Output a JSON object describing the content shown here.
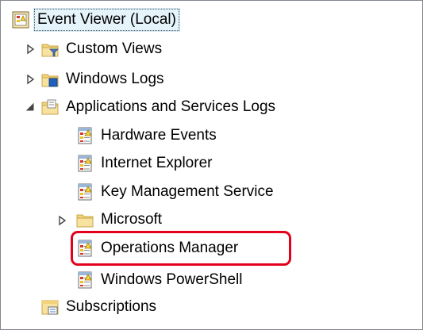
{
  "tree": {
    "root": {
      "label": "Event Viewer (Local)",
      "icon": "event-viewer-icon"
    },
    "nodes": [
      {
        "label": "Custom Views",
        "icon": "filter-folder-icon",
        "expander": "collapsed"
      },
      {
        "label": "Windows Logs",
        "icon": "windows-folder-icon",
        "expander": "collapsed"
      },
      {
        "label": "Applications and Services Logs",
        "icon": "folder-icon",
        "expander": "expanded"
      },
      {
        "label": "Hardware Events",
        "icon": "log-icon"
      },
      {
        "label": "Internet Explorer",
        "icon": "log-icon"
      },
      {
        "label": "Key Management Service",
        "icon": "log-icon"
      },
      {
        "label": "Microsoft",
        "icon": "folder-icon",
        "expander": "collapsed"
      },
      {
        "label": "Operations Manager",
        "icon": "log-icon",
        "highlighted": true
      },
      {
        "label": "Windows PowerShell",
        "icon": "log-icon"
      },
      {
        "label": "Subscriptions",
        "icon": "subscriptions-icon"
      }
    ]
  },
  "highlight_color": "#e4001b"
}
